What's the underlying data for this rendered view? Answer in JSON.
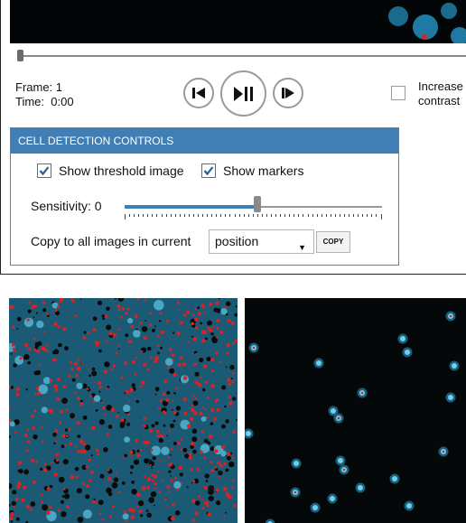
{
  "player": {
    "frame_label": "Frame: 1",
    "time_label": "Time:  0:00",
    "scrub_position": 0
  },
  "contrast": {
    "checked": false,
    "label_line1": "Increase",
    "label_line2": "contrast"
  },
  "cell_detection": {
    "header": "CELL DETECTION CONTROLS",
    "show_threshold": {
      "label": "Show threshold image",
      "checked": true
    },
    "show_markers": {
      "label": "Show markers",
      "checked": true
    },
    "sensitivity_label": "Sensitivity: 0",
    "sensitivity_fraction": 0.5,
    "copy_label": "Copy to all images in current",
    "copy_scope_selected": "position",
    "copy_button": "COPY"
  },
  "colors": {
    "accent": "#3f7fb5",
    "threshold_blue": "#1b5a74",
    "marker_red": "#e02020",
    "cell_cyan": "#3aa0c8"
  },
  "icons": {
    "prev_frame": "step-back-icon",
    "play_pause": "play-pause-icon",
    "next_frame": "step-forward-icon",
    "check": "check-icon",
    "dropdown": "caret-down-icon"
  }
}
